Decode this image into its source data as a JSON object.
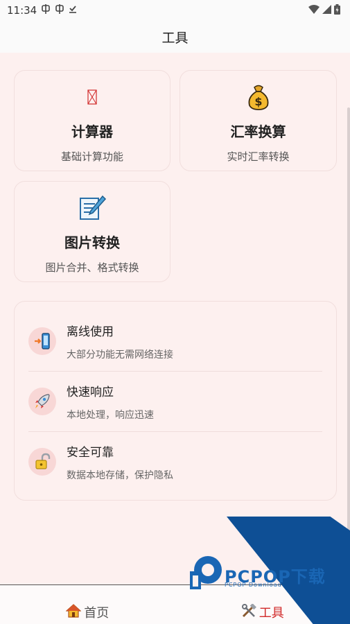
{
  "status_bar": {
    "time": "11:34"
  },
  "app_bar": {
    "title": "工具"
  },
  "cards": [
    {
      "title": "计算器",
      "desc": "基础计算功能",
      "icon": "calculator-icon"
    },
    {
      "title": "汇率换算",
      "desc": "实时汇率转换",
      "icon": "money-bag-icon"
    },
    {
      "title": "图片转换",
      "desc": "图片合并、格式转换",
      "icon": "memo-icon"
    }
  ],
  "features": [
    {
      "title": "离线使用",
      "desc": "大部分功能无需网络连接",
      "icon": "mobile-arrow-icon"
    },
    {
      "title": "快速响应",
      "desc": "本地处理，响应迅速",
      "icon": "rocket-icon"
    },
    {
      "title": "安全可靠",
      "desc": "数据本地存储，保护隐私",
      "icon": "lock-icon"
    }
  ],
  "watermark": {
    "brand": "PCPOP下载",
    "sub": "PCPOP Download"
  },
  "bottom_nav": {
    "home_label": "首页",
    "tools_label": "工具"
  },
  "colors": {
    "accent": "#d12a2a",
    "background": "#fdf0ef",
    "badge": "#f8d7d6"
  }
}
